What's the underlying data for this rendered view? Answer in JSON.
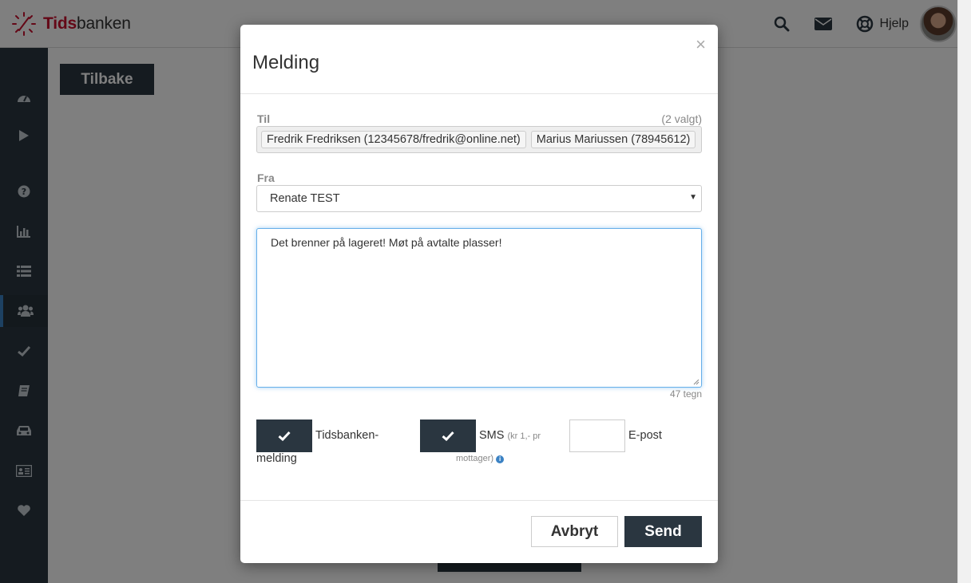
{
  "app": {
    "logo_part1": "Tids",
    "logo_part2": "banken",
    "help_label": "Hjelp",
    "back_label": "Tilbake"
  },
  "sidebar": {
    "items": [
      {
        "icon": "dashboard-icon"
      },
      {
        "icon": "play-icon"
      },
      {
        "icon": "question-icon"
      },
      {
        "icon": "bar-chart-icon"
      },
      {
        "icon": "list-icon"
      },
      {
        "icon": "users-icon",
        "active": true
      },
      {
        "icon": "check-icon"
      },
      {
        "icon": "book-icon"
      },
      {
        "icon": "car-icon"
      },
      {
        "icon": "id-card-icon"
      },
      {
        "icon": "heart-icon"
      }
    ]
  },
  "modal": {
    "title": "Melding",
    "close": "×",
    "to_label": "Til",
    "to_count": "(2 valgt)",
    "recipients": [
      "Fredrik Fredriksen (12345678/fredrik@online.net)",
      "Marius Mariussen (78945612)"
    ],
    "from_label": "Fra",
    "from_value": "Renate TEST",
    "message": "Det brenner på lageret! Møt på avtalte plasser!",
    "char_count": "47 tegn",
    "options": {
      "tidsbanken_label": "Tidsbanken-",
      "tidsbanken_label2": "melding",
      "tidsbanken_checked": true,
      "sms_label": "SMS",
      "sms_note": "(kr 1,- pr",
      "sms_note2": "mottager)",
      "sms_checked": true,
      "email_label": "E-post",
      "email_checked": false
    },
    "cancel_label": "Avbryt",
    "send_label": "Send"
  },
  "colors": {
    "dark": "#2a3640",
    "accent": "#3b82c4",
    "brand_red": "#c8102e"
  }
}
